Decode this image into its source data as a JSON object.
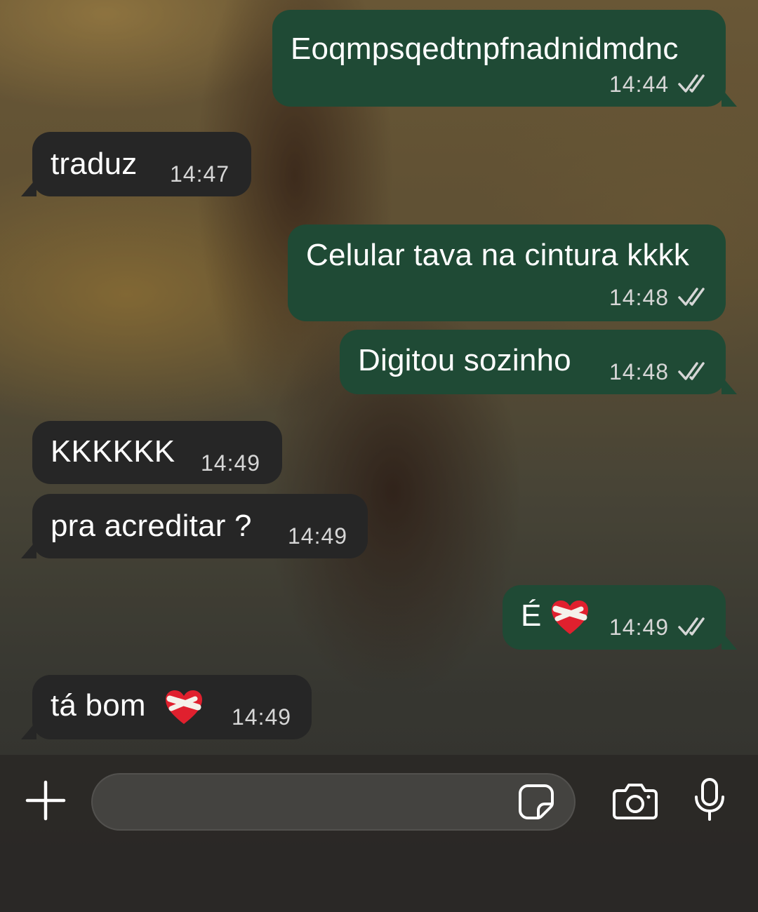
{
  "messages": [
    {
      "direction": "out",
      "text": "Eoqmpsqedtnpfnadnidmdnc",
      "time": "14:44",
      "status": "read"
    },
    {
      "direction": "in",
      "text": "traduz",
      "time": "14:47"
    },
    {
      "direction": "out",
      "text": "Celular tava na cintura kkkk",
      "time": "14:48",
      "status": "read"
    },
    {
      "direction": "out",
      "text": "Digitou sozinho",
      "time": "14:48",
      "status": "read"
    },
    {
      "direction": "in",
      "text": "KKKKKK",
      "time": "14:49"
    },
    {
      "direction": "in",
      "text": "pra acreditar ?",
      "time": "14:49"
    },
    {
      "direction": "out",
      "text": "É",
      "emoji": "mending-heart",
      "time": "14:49",
      "status": "read"
    },
    {
      "direction": "in",
      "text": "tá bom",
      "emoji": "mending-heart",
      "time": "14:49"
    }
  ],
  "composer": {
    "input_placeholder": "",
    "icons": [
      "plus-icon",
      "sticker-icon",
      "camera-icon",
      "microphone-icon"
    ]
  },
  "colors": {
    "outgoing_bubble": "#1f4a35",
    "incoming_bubble": "#262626",
    "read_ticks": "#d6d6d6"
  }
}
